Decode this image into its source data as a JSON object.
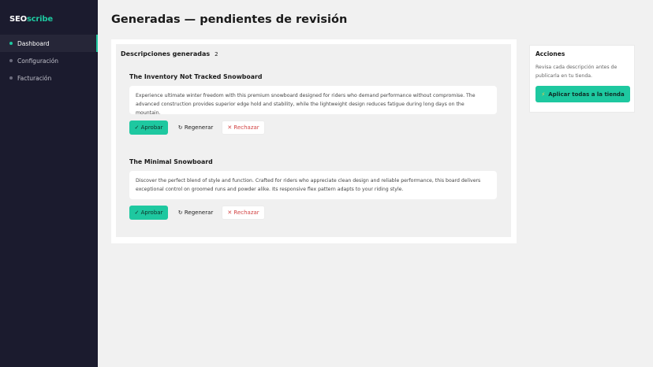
{
  "app": {
    "logo_primary": "SEO",
    "logo_accent": "scribe"
  },
  "sidebar": {
    "items": [
      {
        "label": "Dashboard",
        "active": true
      },
      {
        "label": "Configuración",
        "active": false
      },
      {
        "label": "Facturación",
        "active": false
      }
    ]
  },
  "page": {
    "title": "Generadas — pendientes de revisión"
  },
  "descriptions": {
    "section_title": "Descripciones generadas",
    "count": "2",
    "items": [
      {
        "product": "The Inventory Not Tracked Snowboard",
        "text": "Experience ultimate winter freedom with this premium snowboard designed for riders who demand performance without compromise. The advanced construction provides superior edge hold and stability, while the lightweight design reduces fatigue during long days on the mountain.",
        "approve_label": "✓ Aprobar",
        "regen_label": "↻ Regenerar",
        "reject_label": "✕ Rechazar"
      },
      {
        "product": "The Minimal Snowboard",
        "text": "Discover the perfect blend of style and function. Crafted for riders who appreciate clean design and reliable performance, this board delivers exceptional control on groomed runs and powder alike. Its responsive flex pattern adapts to your riding style.",
        "approve_label": "✓ Aprobar",
        "regen_label": "↻ Regenerar",
        "reject_label": "✕ Rechazar"
      }
    ]
  },
  "actions": {
    "title": "Acciones",
    "text": "Revisa cada descripción antes de publicarla en tu tienda.",
    "apply_all_icon": "⚡",
    "apply_all_label": "Aplicar todas a la tienda"
  },
  "colors": {
    "accent": "#1ec8a0",
    "sidebar_bg": "#1b1b2e",
    "reject": "#d24545"
  }
}
